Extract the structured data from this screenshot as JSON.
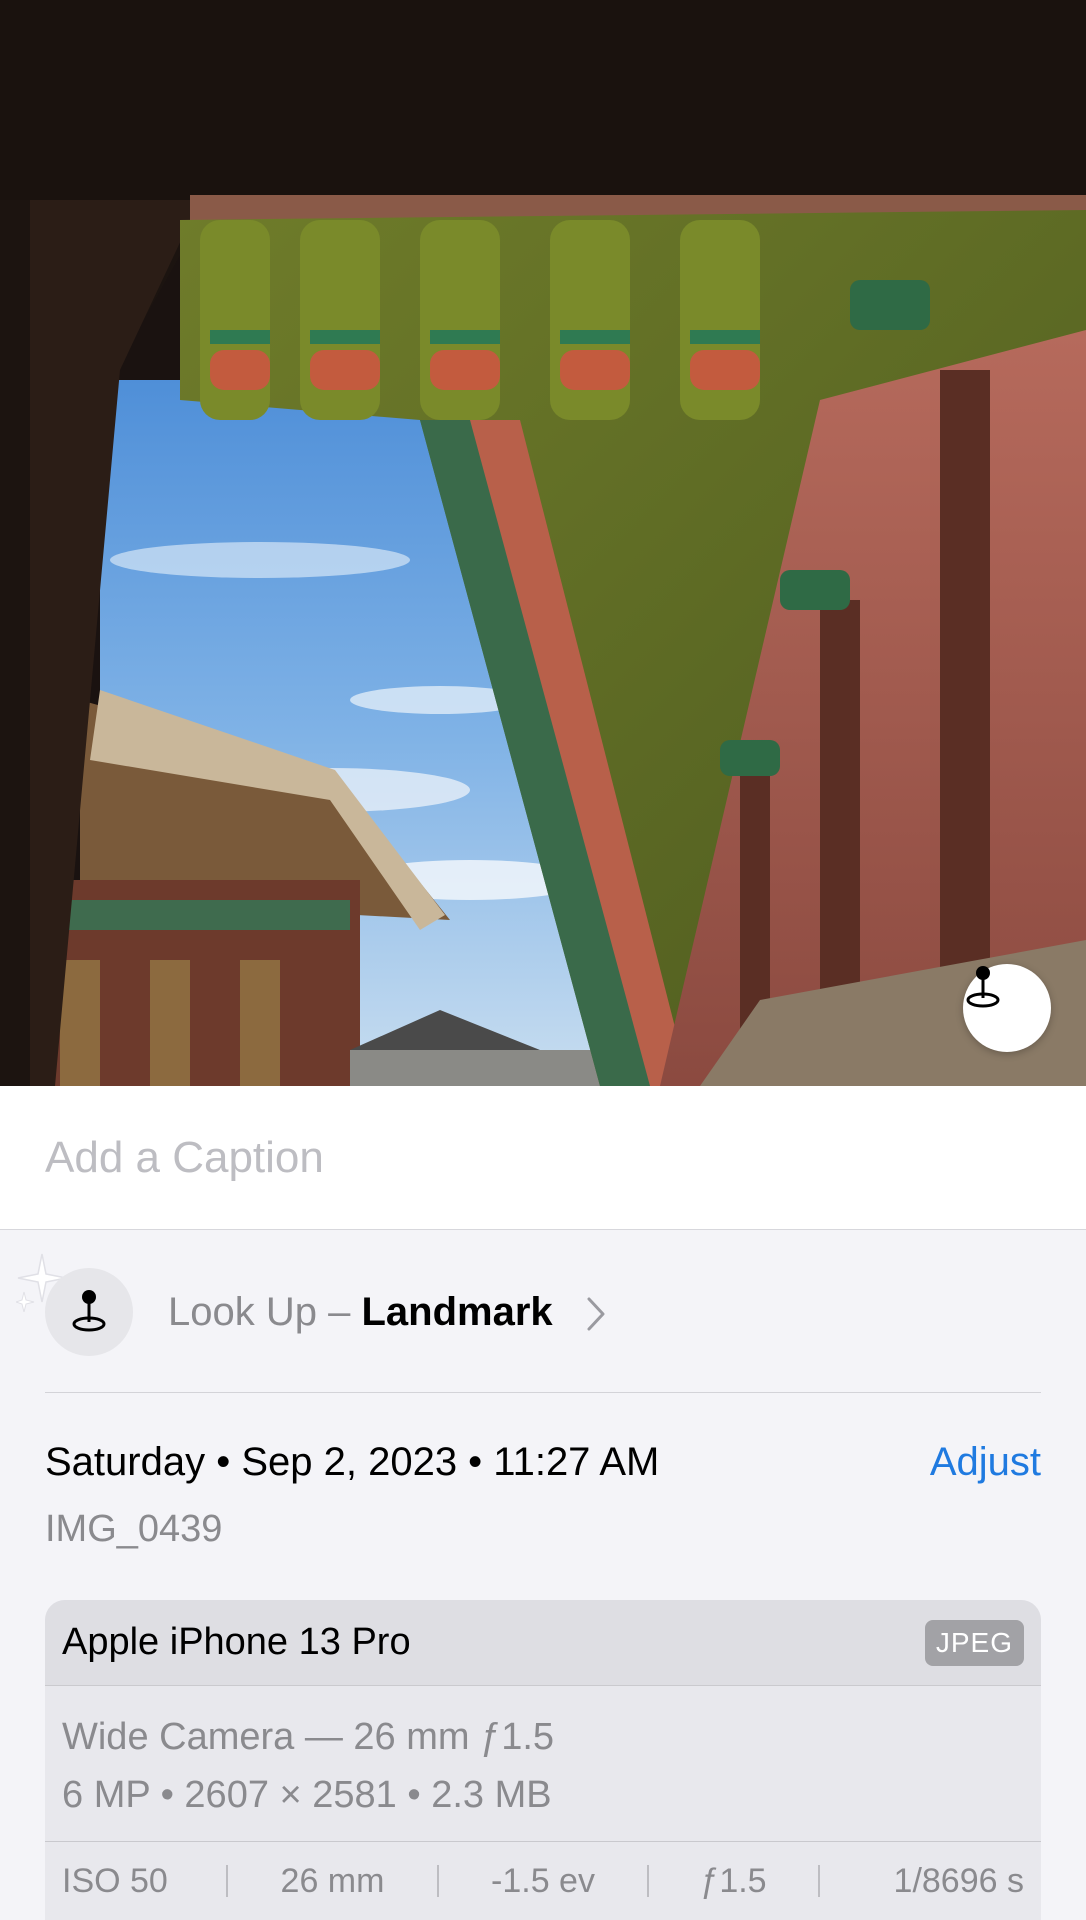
{
  "photo": {
    "alt": "Palace eaves and courtyard",
    "lookup_icon": "landmark-pin-icon"
  },
  "caption": {
    "placeholder": "Add a Caption"
  },
  "lookup": {
    "prefix": "Look Up – ",
    "subject": "Landmark",
    "icon": "landmark-pin-icon",
    "chevron_icon": "chevron-right-icon",
    "sparkle_icon": "sparkle-icon"
  },
  "details": {
    "date_time": "Saturday • Sep 2, 2023 • 11:27 AM",
    "adjust_label": "Adjust",
    "filename": "IMG_0439"
  },
  "camera": {
    "device": "Apple iPhone 13 Pro",
    "format_badge": "JPEG",
    "lens": "Wide Camera — 26 mm ƒ1.5",
    "specs": "6 MP  •  2607 × 2581  •  2.3 MB",
    "exif": [
      "ISO 50",
      "26 mm",
      "-1.5 ev",
      "ƒ1.5",
      "1/8696 s"
    ]
  },
  "colors": {
    "accent": "#1f7ae0",
    "secondary_text": "#8a8a8e",
    "panel_bg": "#f4f4f8"
  }
}
